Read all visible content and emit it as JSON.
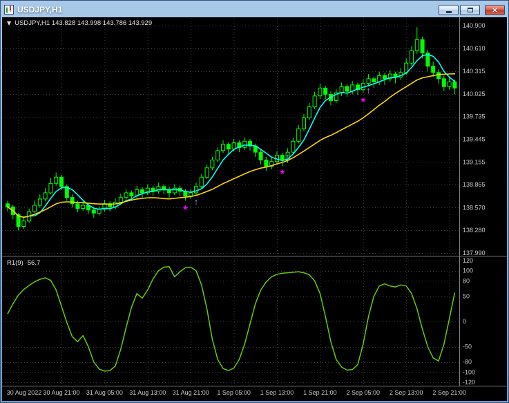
{
  "window": {
    "title": "USDJPY,H1",
    "controls": [
      {
        "name": "minimize"
      },
      {
        "name": "maximize"
      },
      {
        "name": "close",
        "glyph": "×"
      }
    ]
  },
  "icons": {
    "collapse": "▼"
  },
  "colors": {
    "background": "#000000",
    "grid": "#3C3C3C",
    "candle_outline": "#00FF00",
    "bull_fill": "#000000",
    "bear_fill": "#00FF00",
    "axis_text": "#C8C8C8",
    "separator": "#808080",
    "readout_text": "#E0E0E0"
  },
  "chart_data": [
    {
      "type": "candlestick",
      "symbol": "USDJPY",
      "timeframe": "H1",
      "readout": "USDJPY,H1 143.828 143.998 143.786 143.929",
      "ohlc": {
        "open": "143.828",
        "high": "143.998",
        "low": "143.786",
        "close": "143.929"
      },
      "ylim": [
        137.99,
        140.9
      ],
      "grid": true,
      "y_axis_labels": [
        "140.900",
        "140.610",
        "140.315",
        "140.025",
        "139.735",
        "139.445",
        "139.155",
        "138.865",
        "138.570",
        "138.280",
        "137.990"
      ],
      "x_labels": [
        "30 Aug 2022",
        "30 Aug 21:00",
        "31 Aug 05:00",
        "31 Aug 13:00",
        "31 Aug 21:00",
        "1 Sep 05:00",
        "1 Sep 13:00",
        "1 Sep 21:00",
        "2 Sep 05:00",
        "2 Sep 13:00",
        "2 Sep 21:00"
      ],
      "x_label_bar_indices": [
        2,
        10,
        18,
        26,
        34,
        42,
        50,
        58,
        66,
        74,
        82
      ],
      "overlays": [
        {
          "name": "fast-ma",
          "period": 5,
          "color": "#00FFFF"
        },
        {
          "name": "slow-ma",
          "period": 20,
          "color": "#FFD700"
        }
      ],
      "markers": [
        {
          "bar": 33,
          "price": 138.58,
          "glyph": "★",
          "kind": "star",
          "color": "#FF00FF",
          "size": 9
        },
        {
          "bar": 35,
          "price": 138.64,
          "glyph": "↑",
          "kind": "arrow-up",
          "color": "#BC8CFF",
          "size": 13
        },
        {
          "bar": 51,
          "price": 139.04,
          "glyph": "★",
          "kind": "star",
          "color": "#FF00FF",
          "size": 9
        },
        {
          "bar": 52,
          "price": 139.22,
          "glyph": "↑",
          "kind": "arrow-up",
          "color": "#BC8CFF",
          "size": 13
        },
        {
          "bar": 66,
          "price": 139.96,
          "glyph": "★",
          "kind": "star",
          "color": "#FF00FF",
          "size": 9
        },
        {
          "bar": 67,
          "price": 140.07,
          "glyph": "↑",
          "kind": "arrow-up",
          "color": "#BC8CFF",
          "size": 13
        }
      ],
      "candles": [
        [
          138.62,
          138.66,
          138.52,
          138.58
        ],
        [
          138.58,
          138.61,
          138.42,
          138.48
        ],
        [
          138.48,
          138.5,
          138.28,
          138.33
        ],
        [
          138.33,
          138.45,
          138.3,
          138.4
        ],
        [
          138.4,
          138.56,
          138.38,
          138.52
        ],
        [
          138.52,
          138.66,
          138.5,
          138.6
        ],
        [
          138.6,
          138.74,
          138.57,
          138.68
        ],
        [
          138.68,
          138.82,
          138.65,
          138.76
        ],
        [
          138.76,
          138.95,
          138.74,
          138.88
        ],
        [
          138.88,
          139.02,
          138.85,
          138.96
        ],
        [
          138.96,
          138.99,
          138.8,
          138.84
        ],
        [
          138.84,
          138.87,
          138.66,
          138.7
        ],
        [
          138.7,
          138.74,
          138.57,
          138.62
        ],
        [
          138.62,
          138.66,
          138.51,
          138.56
        ],
        [
          138.56,
          138.65,
          138.53,
          138.6
        ],
        [
          138.6,
          138.63,
          138.49,
          138.54
        ],
        [
          138.54,
          138.58,
          138.44,
          138.5
        ],
        [
          138.5,
          138.59,
          138.47,
          138.55
        ],
        [
          138.55,
          138.67,
          138.52,
          138.62
        ],
        [
          138.62,
          138.65,
          138.52,
          138.58
        ],
        [
          138.58,
          138.69,
          138.55,
          138.64
        ],
        [
          138.64,
          138.75,
          138.61,
          138.7
        ],
        [
          138.7,
          138.81,
          138.67,
          138.76
        ],
        [
          138.76,
          138.79,
          138.66,
          138.72
        ],
        [
          138.72,
          138.85,
          138.69,
          138.8
        ],
        [
          138.8,
          138.83,
          138.7,
          138.76
        ],
        [
          138.76,
          138.87,
          138.73,
          138.82
        ],
        [
          138.82,
          138.85,
          138.72,
          138.78
        ],
        [
          138.78,
          138.89,
          138.75,
          138.84
        ],
        [
          138.84,
          138.87,
          138.74,
          138.8
        ],
        [
          138.8,
          138.84,
          138.7,
          138.76
        ],
        [
          138.76,
          138.87,
          138.73,
          138.82
        ],
        [
          138.82,
          138.85,
          138.72,
          138.78
        ],
        [
          138.78,
          138.81,
          138.66,
          138.72
        ],
        [
          138.72,
          138.81,
          138.68,
          138.76
        ],
        [
          138.76,
          138.89,
          138.73,
          138.84
        ],
        [
          138.84,
          139.0,
          138.82,
          138.96
        ],
        [
          138.96,
          139.12,
          138.94,
          139.08
        ],
        [
          139.08,
          139.22,
          139.05,
          139.18
        ],
        [
          139.18,
          139.34,
          139.15,
          139.3
        ],
        [
          139.3,
          139.43,
          139.27,
          139.38
        ],
        [
          139.38,
          139.41,
          139.26,
          139.32
        ],
        [
          139.32,
          139.45,
          139.29,
          139.4
        ],
        [
          139.4,
          139.43,
          139.28,
          139.34
        ],
        [
          139.34,
          139.47,
          139.31,
          139.42
        ],
        [
          139.42,
          139.45,
          139.3,
          139.36
        ],
        [
          139.36,
          139.39,
          139.22,
          139.28
        ],
        [
          139.28,
          139.31,
          139.12,
          139.18
        ],
        [
          139.18,
          139.22,
          139.04,
          139.1
        ],
        [
          139.1,
          139.21,
          139.06,
          139.16
        ],
        [
          139.16,
          139.29,
          139.12,
          139.24
        ],
        [
          139.24,
          139.27,
          139.1,
          139.18
        ],
        [
          139.18,
          139.33,
          139.14,
          139.28
        ],
        [
          139.28,
          139.47,
          139.25,
          139.42
        ],
        [
          139.42,
          139.63,
          139.39,
          139.58
        ],
        [
          139.58,
          139.77,
          139.55,
          139.72
        ],
        [
          139.72,
          139.91,
          139.69,
          139.86
        ],
        [
          139.86,
          140.05,
          139.83,
          140.0
        ],
        [
          140.0,
          140.16,
          139.96,
          140.1
        ],
        [
          140.1,
          140.13,
          139.96,
          140.02
        ],
        [
          140.02,
          140.06,
          139.88,
          139.94
        ],
        [
          139.94,
          140.09,
          139.91,
          140.04
        ],
        [
          140.04,
          140.17,
          140.0,
          140.12
        ],
        [
          140.12,
          140.15,
          139.99,
          140.06
        ],
        [
          140.06,
          140.19,
          140.02,
          140.14
        ],
        [
          140.14,
          140.17,
          140.01,
          140.08
        ],
        [
          140.08,
          140.21,
          140.04,
          140.16
        ],
        [
          140.16,
          140.28,
          140.12,
          140.22
        ],
        [
          140.22,
          140.25,
          140.1,
          140.18
        ],
        [
          140.18,
          140.31,
          140.14,
          140.26
        ],
        [
          140.26,
          140.29,
          140.14,
          140.22
        ],
        [
          140.22,
          140.33,
          140.18,
          140.28
        ],
        [
          140.28,
          140.31,
          140.16,
          140.24
        ],
        [
          140.24,
          140.36,
          140.2,
          140.3
        ],
        [
          140.3,
          140.48,
          140.27,
          140.42
        ],
        [
          140.42,
          140.64,
          140.39,
          140.58
        ],
        [
          140.58,
          140.88,
          140.54,
          140.72
        ],
        [
          140.72,
          140.76,
          140.48,
          140.55
        ],
        [
          140.55,
          140.59,
          140.32,
          140.38
        ],
        [
          140.38,
          140.44,
          140.24,
          140.3
        ],
        [
          140.3,
          140.34,
          140.16,
          140.22
        ],
        [
          140.22,
          140.26,
          140.06,
          140.12
        ],
        [
          140.12,
          140.24,
          140.08,
          140.18
        ],
        [
          140.18,
          140.21,
          140.02,
          140.1
        ]
      ]
    },
    {
      "type": "line",
      "label": "R1(9)",
      "value_readout": "56.7",
      "color": "#66CD00",
      "ylim": [
        -120,
        120
      ],
      "y_axis_labels": [
        120,
        100,
        80,
        50,
        0,
        -50,
        -80,
        -100,
        -120
      ],
      "values": [
        15,
        35,
        52,
        63,
        71,
        78,
        83,
        86,
        81,
        62,
        30,
        -2,
        -30,
        -40,
        -28,
        -50,
        -80,
        -94,
        -98,
        -97,
        -88,
        -55,
        -12,
        28,
        55,
        46,
        62,
        84,
        100,
        107,
        108,
        88,
        98,
        106,
        107,
        100,
        72,
        25,
        -35,
        -75,
        -93,
        -97,
        -92,
        -75,
        -45,
        -5,
        35,
        62,
        78,
        88,
        93,
        95,
        96,
        97,
        98,
        96,
        92,
        80,
        55,
        10,
        -40,
        -75,
        -90,
        -96,
        -95,
        -85,
        -45,
        10,
        50,
        70,
        74,
        70,
        68,
        72,
        70,
        55,
        25,
        -15,
        -50,
        -72,
        -78,
        -45,
        5,
        56.7
      ]
    }
  ]
}
